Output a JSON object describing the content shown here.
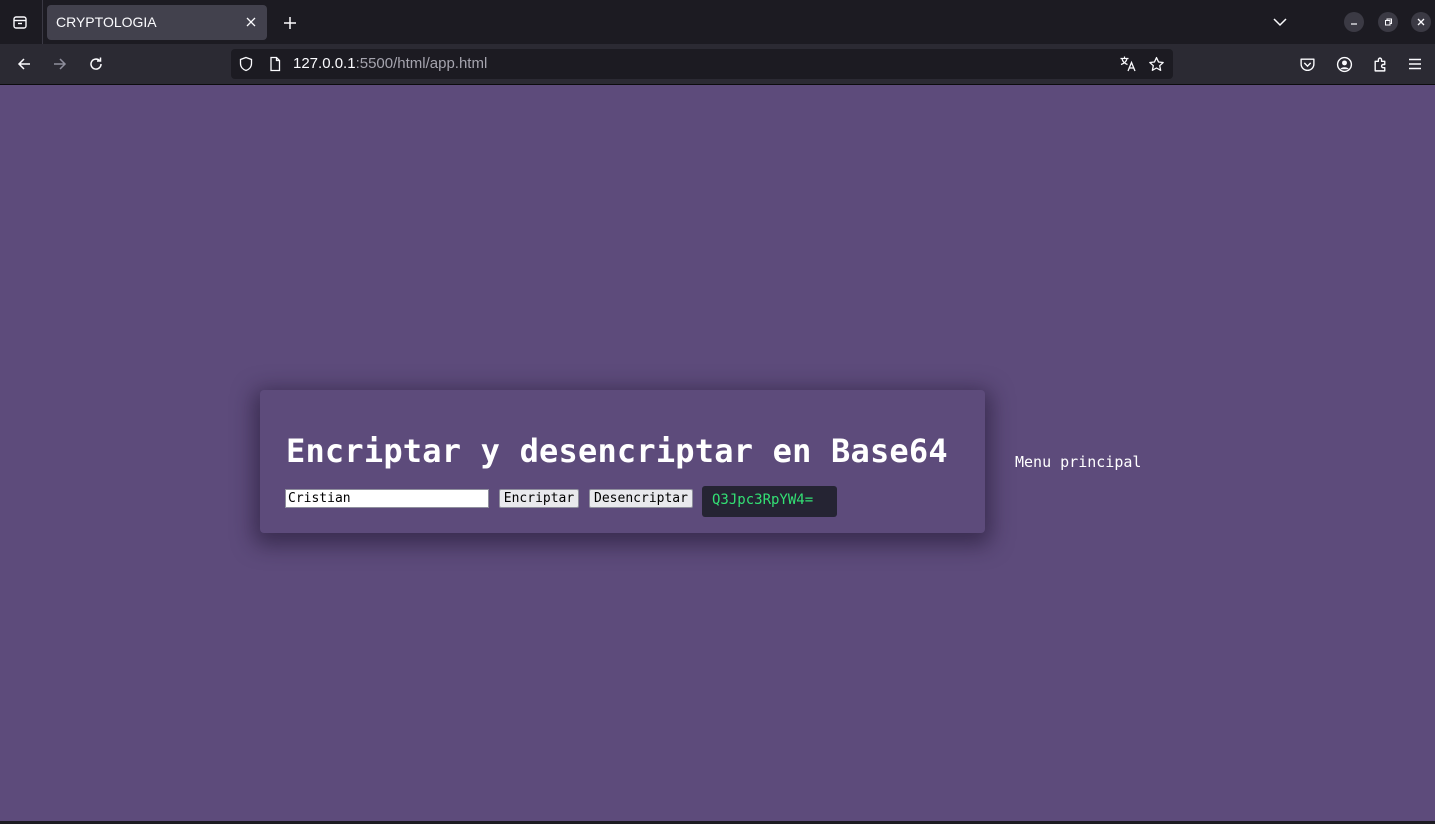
{
  "browser": {
    "tab_title": "CRYPTOLOGIA",
    "url_host": "127.0.0.1",
    "url_rest": ":5500/html/app.html",
    "icons": [
      "tab-list-icon",
      "close-icon",
      "plus-icon",
      "chevron-down-icon",
      "minimize-icon",
      "restore-icon",
      "close-window-icon",
      "back-arrow-icon",
      "forward-arrow-icon",
      "reload-icon",
      "shield-icon",
      "page-icon",
      "translate-icon",
      "star-icon",
      "pocket-icon",
      "account-icon",
      "extensions-icon",
      "hamburger-menu-icon"
    ]
  },
  "page": {
    "background_color": "#5d4b7b",
    "title": "Encriptar y desencriptar en Base64",
    "input_value": "Cristian",
    "encrypt_label": "Encriptar",
    "decrypt_label": "Desencriptar",
    "result": "Q3Jpc3RpYW4=",
    "result_color": "#33e074",
    "menu_link": "Menu principal"
  }
}
